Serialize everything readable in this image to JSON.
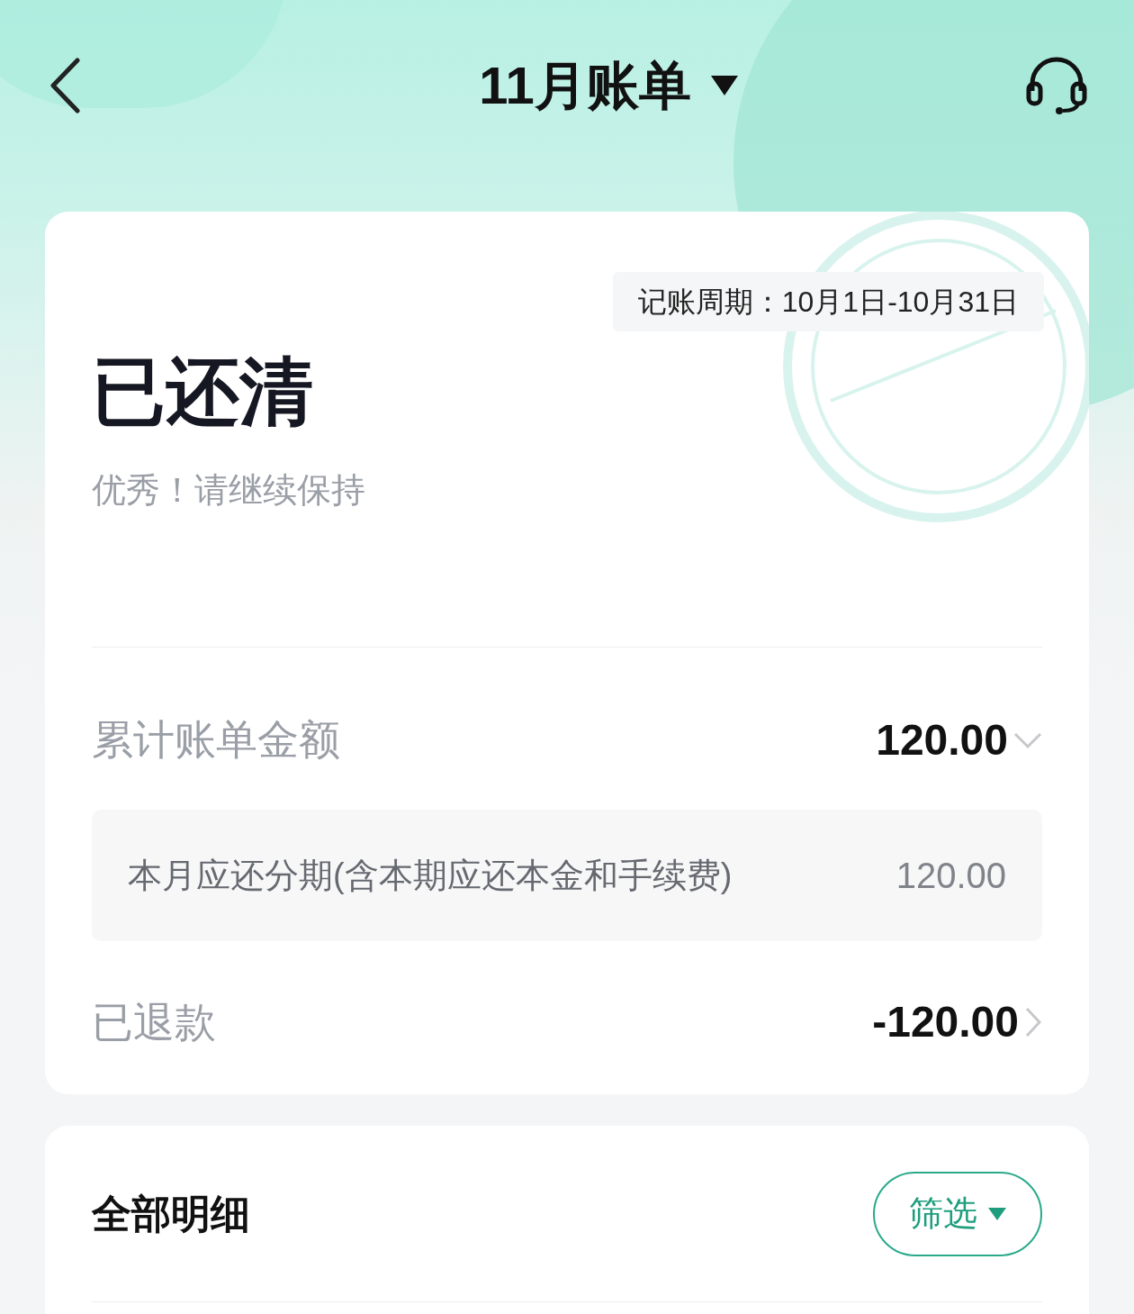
{
  "header": {
    "title": "11月账单"
  },
  "summary": {
    "period": "记账周期：10月1日-10月31日",
    "status": "已还清",
    "message": "优秀！请继续保持",
    "rows": [
      {
        "kind": "expand",
        "label": "累计账单金额",
        "amount": "120.00",
        "expanded": true,
        "details": [
          {
            "label": "本月应还分期(含本期应还本金和手续费)",
            "amount": "120.00"
          }
        ]
      },
      {
        "kind": "link",
        "label": "已退款",
        "amount": "-120.00"
      }
    ]
  },
  "details": {
    "title": "全部明细",
    "filter": "筛选"
  }
}
